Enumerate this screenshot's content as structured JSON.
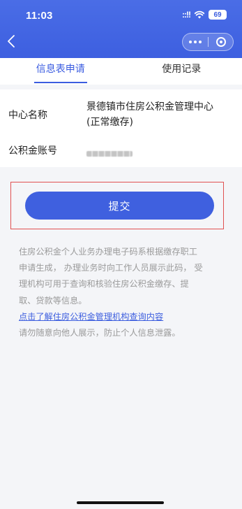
{
  "status_bar": {
    "time": "11:03",
    "signal": "::!!",
    "battery": "69"
  },
  "nav": {
    "back_icon": "chevron-left-icon",
    "more_icon": "more-dots-icon",
    "close_icon": "target-close-icon"
  },
  "tabs": [
    {
      "label": "信息表申请",
      "active": true
    },
    {
      "label": "使用记录",
      "active": false
    }
  ],
  "info": {
    "center_label": "中心名称",
    "center_value": "景德镇市住房公积金管理中心(正常缴存)",
    "account_label": "公积金账号"
  },
  "submit_label": "提交",
  "notice": {
    "line1": "住房公积金个人业务办理电子码系根据缴存职工",
    "line2": "申请生成，  办理业务时向工作人员展示此码，  受",
    "line3": "理机构可用于查询和核验住房公积金缴存、提",
    "line4": "取、贷款等信息。",
    "link": "点击了解住房公积金管理机构查询内容",
    "line5": "请勿随意向他人展示，防止个人信息泄露。"
  },
  "colors": {
    "primary": "#3f60df",
    "header": "#4165e4",
    "highlight_border": "#e05050"
  }
}
